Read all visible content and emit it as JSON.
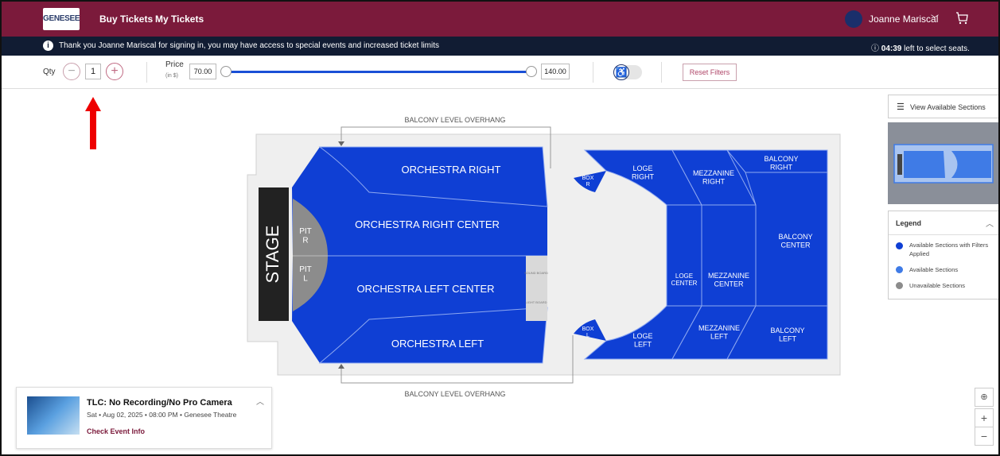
{
  "nav": {
    "logo_text": "GENESEE",
    "buy_tickets": "Buy Tickets",
    "my_tickets": "My Tickets",
    "user_name": "Joanne Mariscal",
    "user_chevron": "﹀",
    "cart_icon": "cart-icon"
  },
  "info_bar": {
    "icon": "i",
    "message": "Thank you Joanne Mariscal for signing in, you may have access to special events and increased ticket limits",
    "timer_icon": "ⓘ",
    "timer_value": "04:39",
    "timer_suffix": "left to select seats."
  },
  "filters": {
    "qty_label": "Qty",
    "qty_minus": "−",
    "qty_value": "1",
    "qty_plus": "+",
    "price_label": "Price",
    "price_unit": "(in $)",
    "price_min": "70.00",
    "price_max": "140.00",
    "accessibility_icon": "♿",
    "reset_label": "Reset Filters"
  },
  "seat_map": {
    "overhang_top": "BALCONY LEVEL OVERHANG",
    "overhang_bottom": "BALCONY LEVEL OVERHANG",
    "stage": "STAGE",
    "pit_r": "PIT R",
    "pit_l": "PIT L",
    "sound_board": "SOUND BOARD",
    "light_board": "LIGHT BOARD",
    "orchestra_right": "ORCHESTRA RIGHT",
    "orchestra_right_center": "ORCHESTRA RIGHT CENTER",
    "orchestra_left_center": "ORCHESTRA LEFT CENTER",
    "orchestra_left": "ORCHESTRA LEFT",
    "box_r": "BOX R",
    "box_l": "BOX L",
    "loge_right": "LOGE RIGHT",
    "loge_center": "LOGE CENTER",
    "loge_left": "LOGE LEFT",
    "mezzanine_right": "MEZZANINE RIGHT",
    "mezzanine_center": "MEZZANINE CENTER",
    "mezzanine_left": "MEZZANINE LEFT",
    "balcony_right": "BALCONY RIGHT",
    "balcony_center": "BALCONY CENTER",
    "balcony_left": "BALCONY LEFT",
    "colors": {
      "available_filtered": "#0f3fd4",
      "available": "#3f7be6",
      "unavailable": "#8c8c8c",
      "stage": "#222222"
    }
  },
  "right_panel": {
    "view_sections_icon": "☰",
    "view_sections_label": "View Available Sections",
    "legend_title": "Legend",
    "legend_chevron": "︿",
    "legend_items": [
      {
        "label": "Available Sections with Filters Applied",
        "color": "#0f3fd4"
      },
      {
        "label": "Available Sections",
        "color": "#3f7be6"
      },
      {
        "label": "Unavailable Sections",
        "color": "#8c8c8c"
      }
    ]
  },
  "event": {
    "title": "TLC: No Recording/No Pro Camera",
    "subtitle": "Sat • Aug 02, 2025 • 08:00 PM • Genesee Theatre",
    "link": "Check Event Info",
    "chevron": "︿"
  },
  "zoom": {
    "locate": "⊕",
    "zoom_in": "+",
    "zoom_out": "−"
  }
}
